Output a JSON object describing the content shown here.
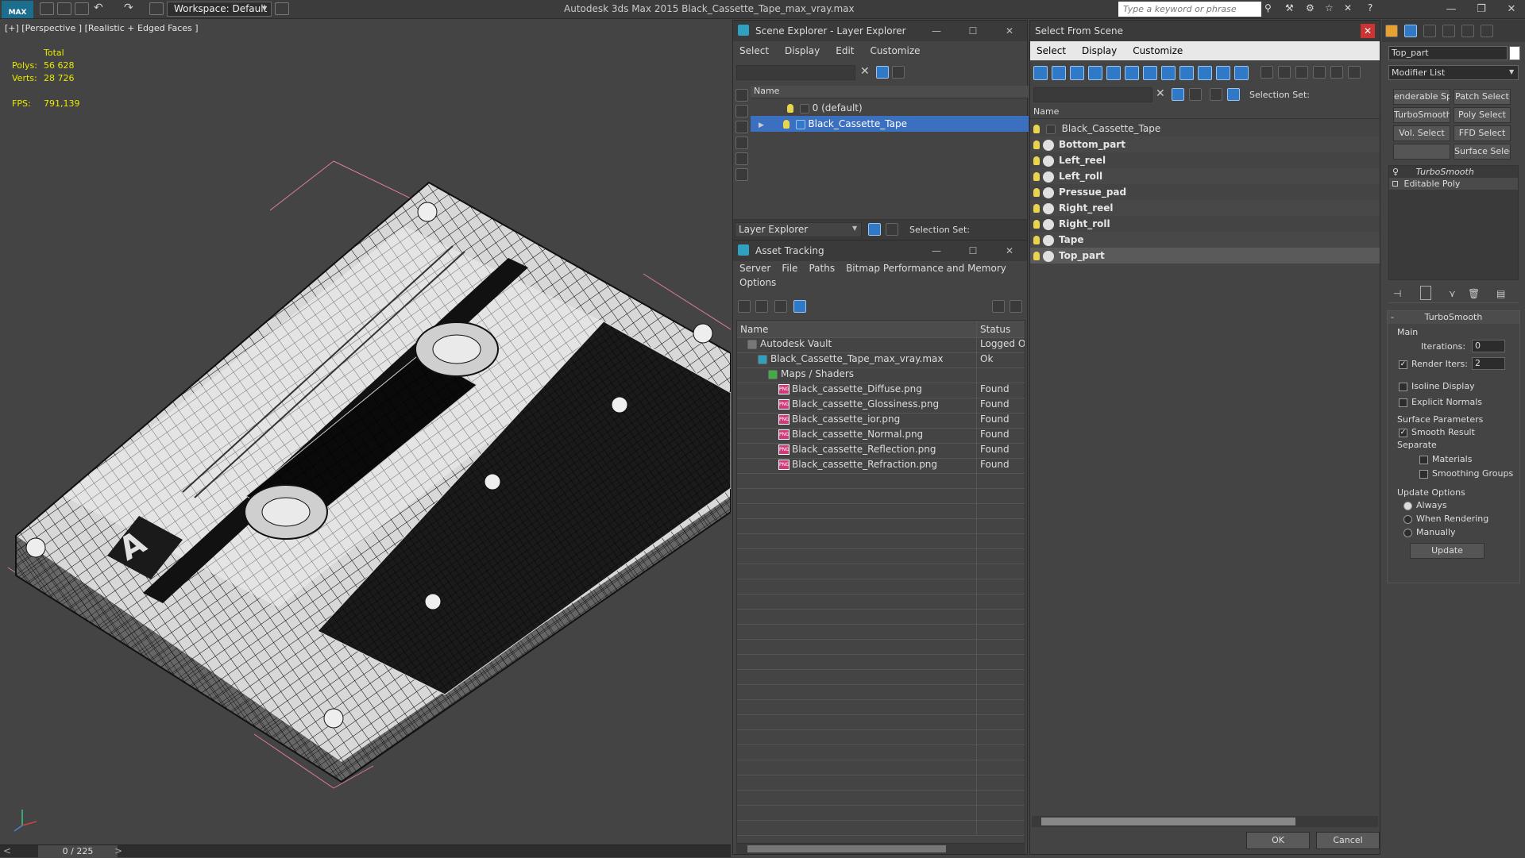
{
  "app": {
    "title": "Autodesk 3ds Max  2015    Black_Cassette_Tape_max_vray.max",
    "logo": "MAX",
    "workspace": "Workspace: Default",
    "search_placeholder": "Type a keyword or phrase"
  },
  "viewport": {
    "label": "[+] [Perspective ] [Realistic + Edged Faces ]",
    "stats": {
      "total_label": "Total",
      "polys_label": "Polys:",
      "polys_value": "56 628",
      "verts_label": "Verts:",
      "verts_value": "28 726",
      "fps_label": "FPS:",
      "fps_value": "791,139"
    },
    "timeline_frame": "0 / 225"
  },
  "scene_explorer": {
    "title": "Scene Explorer - Layer Explorer",
    "menu": [
      "Select",
      "Display",
      "Edit",
      "Customize"
    ],
    "column_name": "Name",
    "layers": [
      {
        "name": "0 (default)",
        "selected": false
      },
      {
        "name": "Black_Cassette_Tape",
        "selected": true
      }
    ],
    "footer_dropdown": "Layer Explorer",
    "selection_set_label": "Selection Set:"
  },
  "asset_tracking": {
    "title": "Asset Tracking",
    "menu": [
      "Server",
      "File",
      "Paths",
      "Bitmap Performance and Memory"
    ],
    "menu2": [
      "Options"
    ],
    "columns": {
      "name": "Name",
      "status": "Status"
    },
    "rows": [
      {
        "name": "Autodesk Vault",
        "status": "Logged Ou",
        "indent": 1,
        "icon": "vault"
      },
      {
        "name": "Black_Cassette_Tape_max_vray.max",
        "status": "Ok",
        "indent": 2,
        "icon": "max"
      },
      {
        "name": "Maps / Shaders",
        "status": "",
        "indent": 3,
        "icon": "maps"
      },
      {
        "name": "Black_cassette_Diffuse.png",
        "status": "Found",
        "indent": 4,
        "icon": "png"
      },
      {
        "name": "Black_cassette_Glossiness.png",
        "status": "Found",
        "indent": 4,
        "icon": "png"
      },
      {
        "name": "Black_cassette_ior.png",
        "status": "Found",
        "indent": 4,
        "icon": "png"
      },
      {
        "name": "Black_cassette_Normal.png",
        "status": "Found",
        "indent": 4,
        "icon": "png"
      },
      {
        "name": "Black_cassette_Reflection.png",
        "status": "Found",
        "indent": 4,
        "icon": "png"
      },
      {
        "name": "Black_cassette_Refraction.png",
        "status": "Found",
        "indent": 4,
        "icon": "png"
      }
    ]
  },
  "select_from_scene": {
    "title": "Select From Scene",
    "menu": [
      "Select",
      "Display",
      "Customize"
    ],
    "selection_set_label": "Selection Set:",
    "column_name": "Name",
    "group": "Black_Cassette_Tape",
    "objects": [
      "Bottom_part",
      "Left_reel",
      "Left_roll",
      "Pressue_pad",
      "Right_reel",
      "Right_roll",
      "Tape",
      "Top_part"
    ],
    "selected_object": "Top_part",
    "ok": "OK",
    "cancel": "Cancel"
  },
  "command_panel": {
    "object_name": "Top_part",
    "modifier_list": "Modifier List",
    "buttons": [
      "enderable Spli",
      "Patch Select",
      "TurboSmooth",
      "Poly Select",
      "Vol. Select",
      "FFD Select",
      "",
      "Surface Select"
    ],
    "stack": [
      "TurboSmooth",
      "Editable Poly"
    ],
    "rollout_title": "TurboSmooth",
    "main_label": "Main",
    "iterations_label": "Iterations:",
    "iterations_value": "0",
    "render_iters_label": "Render Iters:",
    "render_iters_value": "2",
    "isoline_label": "Isoline Display",
    "explicit_label": "Explicit Normals",
    "surface_params_label": "Surface Parameters",
    "smooth_result_label": "Smooth Result",
    "separate_label": "Separate",
    "materials_label": "Materials",
    "smoothing_groups_label": "Smoothing Groups",
    "update_options_label": "Update Options",
    "always_label": "Always",
    "when_rendering_label": "When Rendering",
    "manually_label": "Manually",
    "update_button": "Update"
  }
}
